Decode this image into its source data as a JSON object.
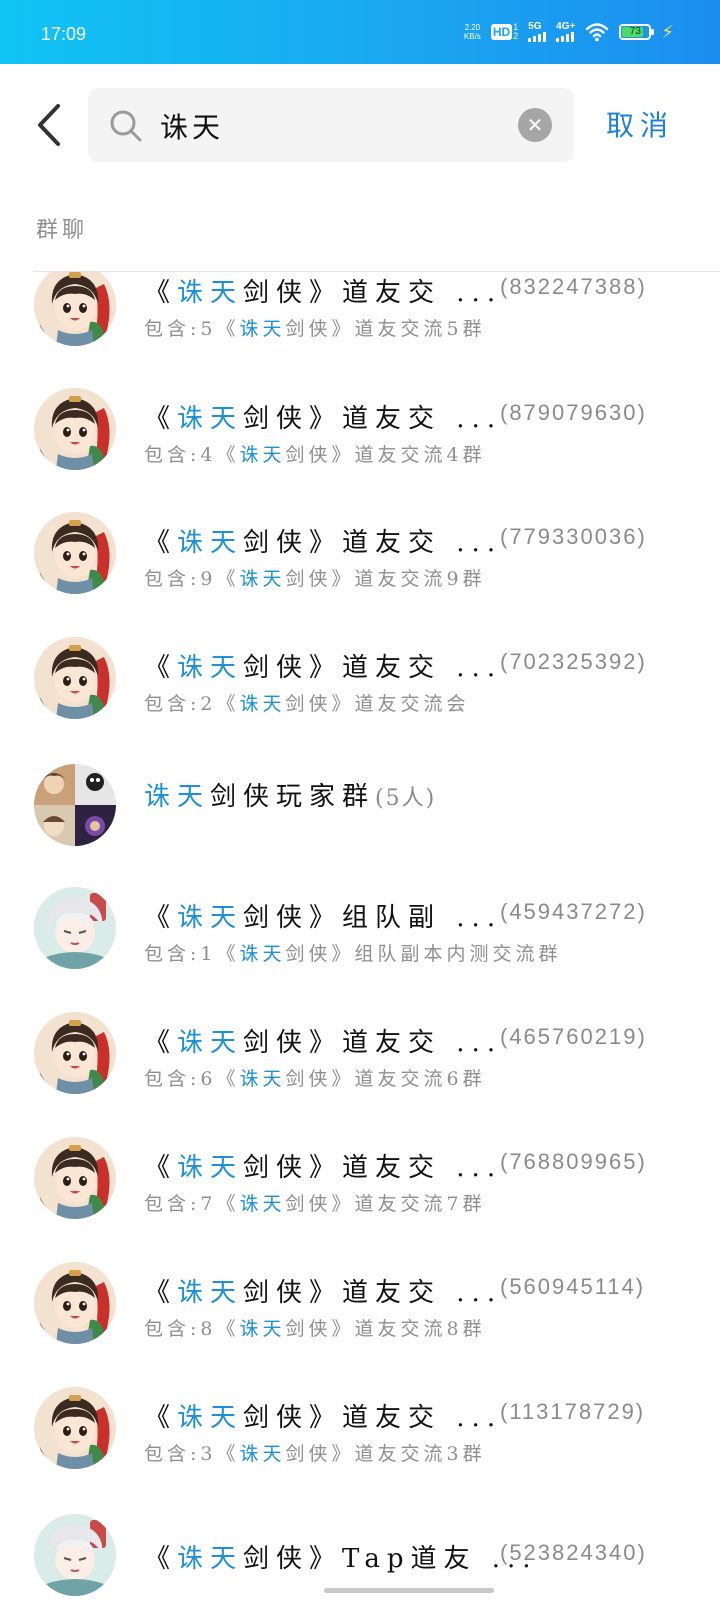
{
  "status_bar": {
    "time": "17:09",
    "net_speed_value": "2.20",
    "net_speed_unit": "KB/s",
    "hd_label": "HD",
    "hd_sub": "1\n2",
    "sig1_label": "5G",
    "sig2_label": "4G+",
    "battery_level": "73",
    "colors": {
      "bg_start": "#10c4f4",
      "bg_end": "#1b8ef0"
    }
  },
  "search": {
    "query": "诛天",
    "clear_icon": "close-circle-icon",
    "cancel_label": "取消"
  },
  "section": {
    "label": "群聊"
  },
  "highlight_color": "#1e90d6",
  "results": [
    {
      "title_pre": "《",
      "title_hl": "诛天",
      "title_post": "剑侠》道友交 ...",
      "id": "(832247388)",
      "sub_pre": "包含:5《",
      "sub_hl": "诛天",
      "sub_post": "剑侠》道友交流5群",
      "avatar": "chibi-hero"
    },
    {
      "title_pre": "《",
      "title_hl": "诛天",
      "title_post": "剑侠》道友交 ...",
      "id": "(879079630)",
      "sub_pre": "包含:4《",
      "sub_hl": "诛天",
      "sub_post": "剑侠》道友交流4群",
      "avatar": "chibi-hero"
    },
    {
      "title_pre": "《",
      "title_hl": "诛天",
      "title_post": "剑侠》道友交 ...",
      "id": "(779330036)",
      "sub_pre": "包含:9《",
      "sub_hl": "诛天",
      "sub_post": "剑侠》道友交流9群",
      "avatar": "chibi-hero"
    },
    {
      "title_pre": "《",
      "title_hl": "诛天",
      "title_post": "剑侠》道友交 ...",
      "id": "(702325392)",
      "sub_pre": "包含:2《",
      "sub_hl": "诛天",
      "sub_post": "剑侠》道友交流会",
      "avatar": "chibi-hero"
    },
    {
      "title_pre": "",
      "title_hl": "诛天",
      "title_post": "剑侠玩家群",
      "count": "(5人)",
      "id": "",
      "sub_pre": "",
      "sub_hl": "",
      "sub_post": "",
      "avatar": "group-collage"
    },
    {
      "title_pre": "《",
      "title_hl": "诛天",
      "title_post": "剑侠》组队副 ...",
      "id": "(459437272)",
      "sub_pre": "包含:1《",
      "sub_hl": "诛天",
      "sub_post": "剑侠》组队副本内测交流群",
      "avatar": "chibi-white-hair"
    },
    {
      "title_pre": "《",
      "title_hl": "诛天",
      "title_post": "剑侠》道友交 ...",
      "id": "(465760219)",
      "sub_pre": "包含:6《",
      "sub_hl": "诛天",
      "sub_post": "剑侠》道友交流6群",
      "avatar": "chibi-hero"
    },
    {
      "title_pre": "《",
      "title_hl": "诛天",
      "title_post": "剑侠》道友交 ...",
      "id": "(768809965)",
      "sub_pre": "包含:7《",
      "sub_hl": "诛天",
      "sub_post": "剑侠》道友交流7群",
      "avatar": "chibi-hero"
    },
    {
      "title_pre": "《",
      "title_hl": "诛天",
      "title_post": "剑侠》道友交 ...",
      "id": "(560945114)",
      "sub_pre": "包含:8《",
      "sub_hl": "诛天",
      "sub_post": "剑侠》道友交流8群",
      "avatar": "chibi-hero"
    },
    {
      "title_pre": "《",
      "title_hl": "诛天",
      "title_post": "剑侠》道友交 ...",
      "id": "(113178729)",
      "sub_pre": "包含:3《",
      "sub_hl": "诛天",
      "sub_post": "剑侠》道友交流3群",
      "avatar": "chibi-hero"
    },
    {
      "title_pre": "《",
      "title_hl": "诛天",
      "title_post": "剑侠》Tap道友 ...",
      "id": "(523824340)",
      "sub_pre": "",
      "sub_hl": "",
      "sub_post": "",
      "avatar": "chibi-white-hair"
    }
  ]
}
